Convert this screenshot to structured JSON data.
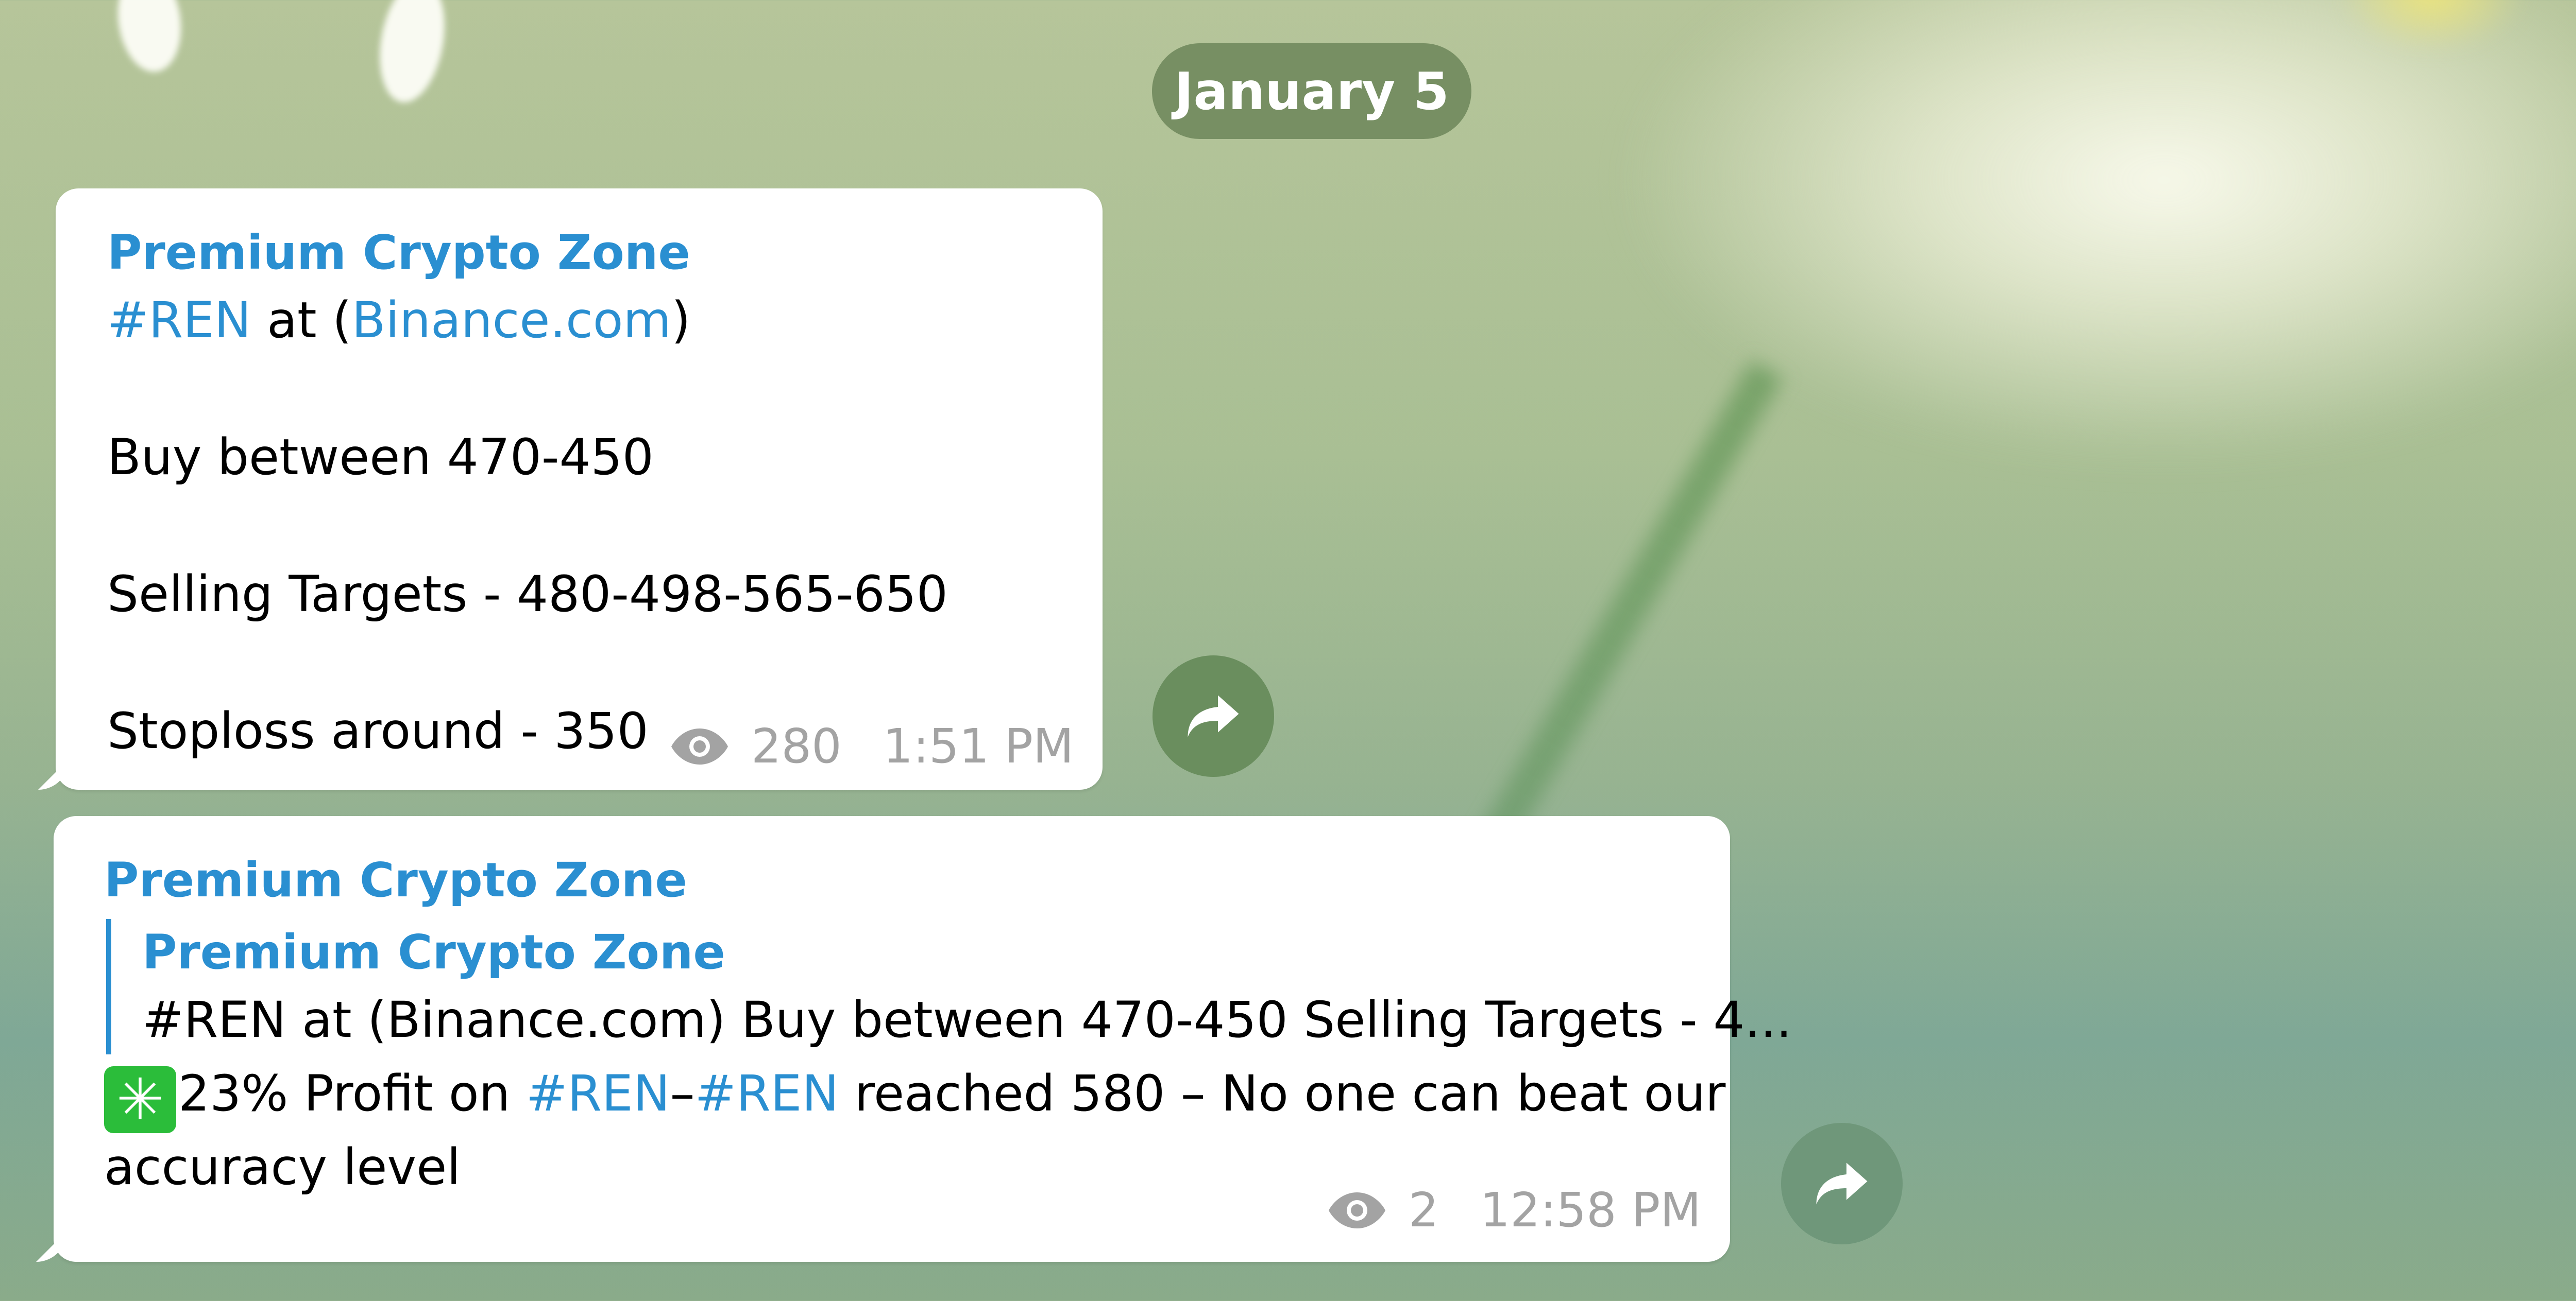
{
  "date_separator": "January 5",
  "messages": [
    {
      "sender": "Premium Crypto Zone",
      "hashtag": "#REN",
      "at_text": " at (",
      "link": "Binance.com",
      "close_paren": ")",
      "buy_line": "Buy between 470-450",
      "targets_line": "Selling Targets - 480-498-565-650",
      "stoploss_line": "Stoploss around - 350",
      "views": "280",
      "time": "1:51 PM"
    },
    {
      "sender": "Premium Crypto Zone",
      "reply": {
        "sender": "Premium Crypto Zone",
        "preview": "#REN at (Binance.com)  Buy between 470-450  Selling Targets - 4..."
      },
      "emoji": "✳",
      "text_part1": "23% Profit on ",
      "hashtag1": "#REN",
      "dash": "–",
      "hashtag2": "#REN",
      "text_part2": " reached 580 – No one can beat our",
      "text_line2": "accuracy level",
      "views": "2",
      "time": "12:58 PM"
    }
  ],
  "icons": {
    "views": "eye-icon",
    "share": "share-arrow-icon"
  },
  "colors": {
    "link": "#2a8fd1",
    "date_pill": "#778f63",
    "share_button": "#6a8e5e"
  }
}
